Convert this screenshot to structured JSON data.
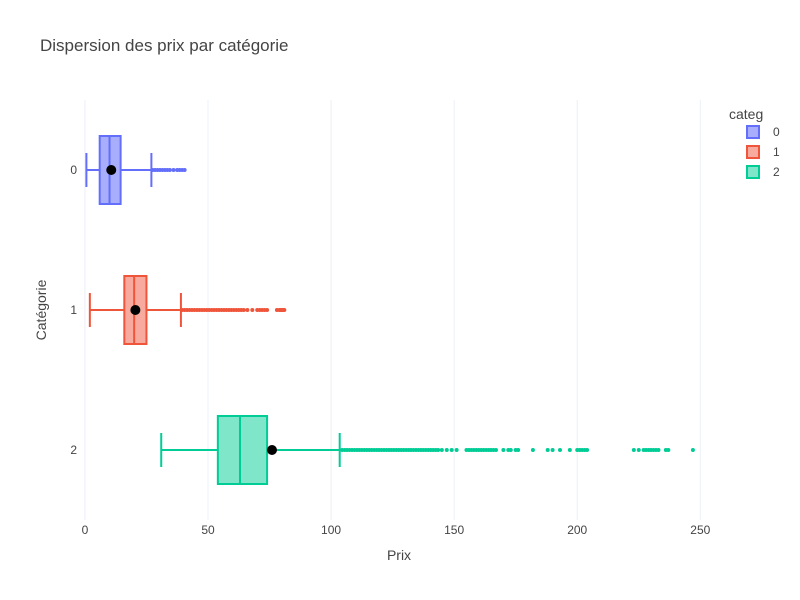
{
  "chart_data": {
    "type": "box",
    "orientation": "horizontal",
    "title": "Dispersion des prix par catégorie",
    "xlabel": "Prix",
    "ylabel": "Catégorie",
    "xlim": [
      -2,
      258
    ],
    "x_ticks": [
      0,
      50,
      100,
      150,
      200,
      250
    ],
    "grid": true,
    "legend": {
      "title": "categ",
      "placement": "top-right"
    },
    "categories": [
      "0",
      "1",
      "2"
    ],
    "series": [
      {
        "name": "0",
        "color": "#636efa",
        "fill": "#a9aefc",
        "min": 0.6,
        "q1": 6,
        "median": 10,
        "q3": 14.5,
        "max": 27,
        "mean": 10.7,
        "outliers": [
          27.5,
          28.5,
          29.5,
          30.5,
          31.5,
          32.5,
          33.5,
          34.5,
          36,
          37.5,
          38.5,
          39.5,
          40.5
        ]
      },
      {
        "name": "1",
        "color": "#ef553b",
        "fill": "#f7aa9d",
        "min": 2,
        "q1": 16,
        "median": 20,
        "q3": 25,
        "max": 39,
        "mean": 20.5,
        "outliers": [
          39.5,
          40.5,
          41.5,
          42.5,
          43.5,
          44.5,
          45.5,
          46.5,
          47.5,
          48.5,
          49.5,
          50.5,
          51.5,
          52.5,
          53.5,
          54.5,
          55.5,
          56.5,
          57.5,
          58.5,
          59.5,
          60.5,
          61.5,
          62.5,
          63.5,
          64.5,
          66,
          68,
          70,
          71,
          72,
          73,
          74,
          78,
          79,
          79.5,
          80,
          80.5,
          81
        ]
      },
      {
        "name": "2",
        "color": "#00cc96",
        "fill": "#80e6ca",
        "min": 31,
        "q1": 54,
        "median": 63,
        "q3": 74,
        "max": 103.5,
        "mean": 76,
        "outliers": [
          104.5,
          105.5,
          106.5,
          107.5,
          108.5,
          109.5,
          110.5,
          111.5,
          112.5,
          113.5,
          114.5,
          115.5,
          116.5,
          117.5,
          118.5,
          119.5,
          120.5,
          121.5,
          122.5,
          123.5,
          124.5,
          125.5,
          126.5,
          127.5,
          128.5,
          129.5,
          130.5,
          131.5,
          132.5,
          133.5,
          134.5,
          135.5,
          136.5,
          137.5,
          138.5,
          139.5,
          140.5,
          141.5,
          142.5,
          143.5,
          145,
          147,
          149,
          151,
          155,
          156,
          157,
          158,
          159,
          160,
          161,
          162,
          163,
          164,
          165,
          166,
          167,
          170,
          172,
          173,
          175,
          176,
          182,
          188,
          190,
          193,
          197,
          200,
          201,
          202,
          203,
          204,
          223,
          225,
          227,
          228,
          229,
          230,
          231,
          232,
          233,
          236,
          237,
          247
        ]
      }
    ]
  }
}
